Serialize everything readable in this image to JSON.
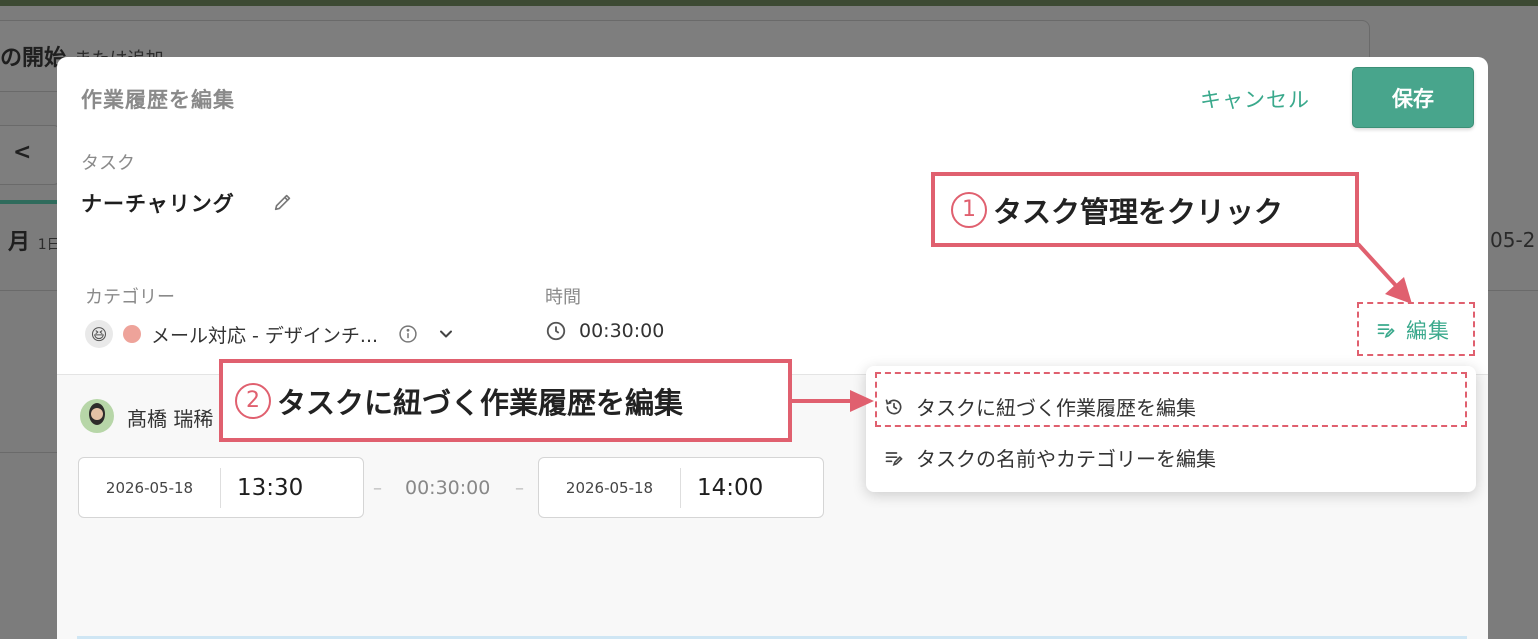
{
  "background": {
    "start_bold": "の開始",
    "start_rest": "または追加",
    "nav_prev": "<",
    "month": "月",
    "month_sub": "1日",
    "date_right": "05-2"
  },
  "modal": {
    "title": "作業履歴を編集",
    "cancel_label": "キャンセル",
    "save_label": "保存",
    "task_label": "タスク",
    "task_name": "ナーチャリング",
    "category_label": "カテゴリー",
    "time_label": "時間",
    "category_value": "メール対応 - デザインチ...",
    "category_emoji": "😆",
    "category_color": "#eea39a",
    "time_value": "00:30:00",
    "edit_label": "編集",
    "user_name": "髙橋 瑞稀",
    "start": {
      "date": "2026-05-18",
      "time": "13:30"
    },
    "duration": "00:30:00",
    "end": {
      "date": "2026-05-18",
      "time": "14:00"
    },
    "sep": "–",
    "accent_color": "#3aa98c",
    "save_color": "#48a58c"
  },
  "menu": {
    "items": [
      {
        "label": "タスクに紐づく作業履歴を編集",
        "icon": "history-icon"
      },
      {
        "label": "タスクの名前やカテゴリーを編集",
        "icon": "edit-list-icon"
      }
    ]
  },
  "callouts": {
    "step1_num": "1",
    "step1_text": "タスク管理をクリック",
    "step2_num": "2",
    "step2_text": "タスクに紐づく作業履歴を編集",
    "color": "#e0606f"
  }
}
